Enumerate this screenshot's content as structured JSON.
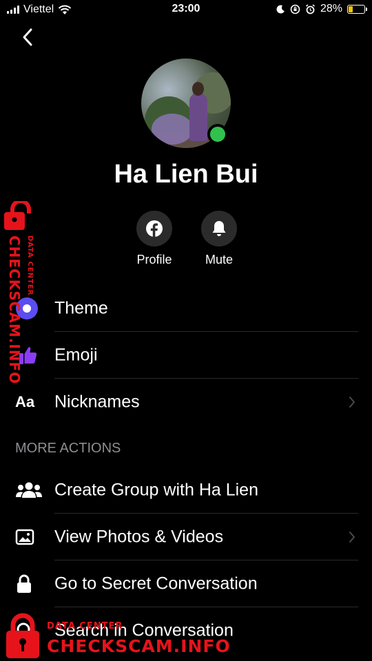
{
  "status_bar": {
    "carrier": "Viettel",
    "time": "23:00",
    "battery_percent": "28%",
    "battery_level": 0.28,
    "battery_color": "#f5c400"
  },
  "nav": {
    "back_icon": "chevron-left-icon"
  },
  "profile": {
    "name": "Ha Lien Bui",
    "online": true,
    "online_color": "#31c24d"
  },
  "actions": [
    {
      "label": "Profile",
      "icon": "facebook-icon"
    },
    {
      "label": "Mute",
      "icon": "bell-icon"
    }
  ],
  "menu": {
    "theme": {
      "label": "Theme",
      "icon": "theme-circle-icon",
      "color": "#5b4df0"
    },
    "emoji": {
      "label": "Emoji",
      "icon": "thumbs-up-icon",
      "color": "#8a3df5"
    },
    "nicknames": {
      "label": "Nicknames",
      "icon": "text-aa-icon"
    }
  },
  "more_actions": {
    "header": "MORE ACTIONS",
    "items": [
      {
        "label": "Create Group with Ha Lien",
        "icon": "people-icon"
      },
      {
        "label": "View Photos & Videos",
        "icon": "photo-icon"
      },
      {
        "label": "Go to Secret Conversation",
        "icon": "lock-icon"
      },
      {
        "label": "Search in Conversation",
        "icon": "search-icon"
      }
    ]
  },
  "watermark": {
    "brand": "CHECKSCAM.INFO",
    "sub": "DATA CENTER",
    "color": "#e6131b"
  }
}
